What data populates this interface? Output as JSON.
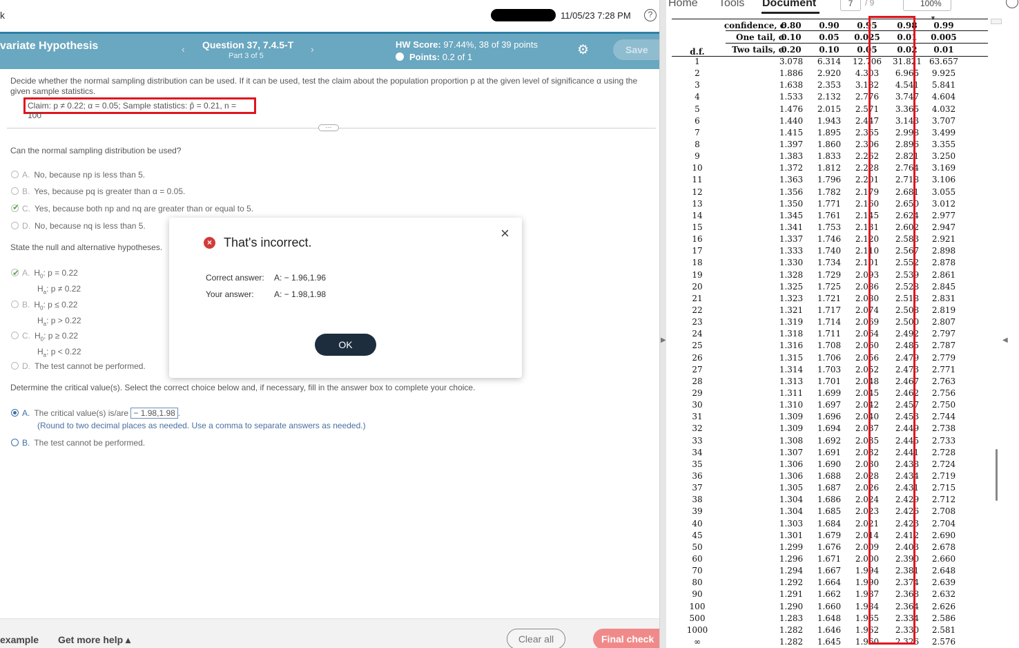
{
  "topbar": {
    "back": "k",
    "timestamp": "11/05/23 7:28 PM",
    "help": "?"
  },
  "header": {
    "title": "variate Hypothesis",
    "question_title": "Question 37, 7.4.5-T",
    "question_part": "Part 3 of 5",
    "prev": "‹",
    "next": "›",
    "hw_score_label": "HW Score:",
    "hw_score_value": "97.44%, 38 of 39 points",
    "points_label": "Points:",
    "points_value": "0.2 of 1",
    "save_label": "Save"
  },
  "content": {
    "intro": "Decide whether the normal sampling distribution can be used. If it can be used, test the claim about the population proportion p at the given level of significance α using the given sample statistics.",
    "claim": "Claim: p ≠ 0.22; α = 0.05; Sample statistics: p̂ = 0.21, n = 100",
    "q1": "Can the normal sampling distribution be used?",
    "q1_options": [
      {
        "letter": "A.",
        "text": "No, because np is less than 5."
      },
      {
        "letter": "B.",
        "text": "Yes, because pq is greater than α = 0.05."
      },
      {
        "letter": "C.",
        "text": "Yes, because both np and nq are greater than or equal to 5."
      },
      {
        "letter": "D.",
        "text": "No, because nq is less than 5."
      }
    ],
    "q2": "State the null and alternative hypotheses.",
    "q2_options": [
      {
        "letter": "A.",
        "h0": "p = 0.22",
        "ha": "p ≠ 0.22"
      },
      {
        "letter": "B.",
        "h0": "p ≤ 0.22",
        "ha": "p > 0.22"
      },
      {
        "letter": "C.",
        "h0": "p ≥ 0.22",
        "ha": "p < 0.22"
      },
      {
        "letter": "D.",
        "text": "The test cannot be performed."
      }
    ],
    "h0_label": "H",
    "h0_sub": "0",
    "ha_label": "H",
    "ha_sub": "a",
    "q3": "Determine the critical value(s). Select the correct choice below and, if necessary, fill in the answer box to complete your choice.",
    "q3_a_letter": "A.",
    "q3_a_text": "The critical value(s) is/are",
    "q3_a_answer": "− 1.98,1.98",
    "q3_a_period": ".",
    "q3_a_hint": "(Round to two decimal places as needed. Use a comma to separate answers as needed.)",
    "q3_b_letter": "B.",
    "q3_b_text": "The test cannot be performed."
  },
  "modal": {
    "title": "That's incorrect.",
    "correct_label": "Correct answer:",
    "correct_value": "A:  − 1.96,1.96",
    "your_label": "Your answer:",
    "your_value": "A:  − 1.98,1.98",
    "ok_label": "OK",
    "close": "×"
  },
  "bottom": {
    "example": "example",
    "more_help": "Get more help ▴",
    "clear_all": "Clear all",
    "final_check": "Final check"
  },
  "viewer": {
    "tabs": [
      "Home",
      "Tools",
      "Document"
    ],
    "page_current": "7",
    "page_total": "/ 9",
    "zoom": "100%",
    "more": "•••"
  },
  "t_table": {
    "header_labels": [
      "confidence, c",
      "One tail, α",
      "Two tails, α"
    ],
    "df_label": "d.f.",
    "confidence": [
      "0.80",
      "0.90",
      "0.95",
      "0.98",
      "0.99"
    ],
    "one_tail": [
      "0.10",
      "0.05",
      "0.025",
      "0.01",
      "0.005"
    ],
    "two_tails": [
      "0.20",
      "0.10",
      "0.05",
      "0.02",
      "0.01"
    ],
    "rows": [
      [
        "1",
        "3.078",
        "6.314",
        "12.706",
        "31.821",
        "63.657"
      ],
      [
        "2",
        "1.886",
        "2.920",
        "4.303",
        "6.965",
        "9.925"
      ],
      [
        "3",
        "1.638",
        "2.353",
        "3.182",
        "4.541",
        "5.841"
      ],
      [
        "4",
        "1.533",
        "2.132",
        "2.776",
        "3.747",
        "4.604"
      ],
      [
        "5",
        "1.476",
        "2.015",
        "2.571",
        "3.365",
        "4.032"
      ],
      [
        "6",
        "1.440",
        "1.943",
        "2.447",
        "3.143",
        "3.707"
      ],
      [
        "7",
        "1.415",
        "1.895",
        "2.365",
        "2.998",
        "3.499"
      ],
      [
        "8",
        "1.397",
        "1.860",
        "2.306",
        "2.896",
        "3.355"
      ],
      [
        "9",
        "1.383",
        "1.833",
        "2.262",
        "2.821",
        "3.250"
      ],
      [
        "10",
        "1.372",
        "1.812",
        "2.228",
        "2.764",
        "3.169"
      ],
      [
        "11",
        "1.363",
        "1.796",
        "2.201",
        "2.718",
        "3.106"
      ],
      [
        "12",
        "1.356",
        "1.782",
        "2.179",
        "2.681",
        "3.055"
      ],
      [
        "13",
        "1.350",
        "1.771",
        "2.160",
        "2.650",
        "3.012"
      ],
      [
        "14",
        "1.345",
        "1.761",
        "2.145",
        "2.624",
        "2.977"
      ],
      [
        "15",
        "1.341",
        "1.753",
        "2.131",
        "2.602",
        "2.947"
      ],
      [
        "16",
        "1.337",
        "1.746",
        "2.120",
        "2.583",
        "2.921"
      ],
      [
        "17",
        "1.333",
        "1.740",
        "2.110",
        "2.567",
        "2.898"
      ],
      [
        "18",
        "1.330",
        "1.734",
        "2.101",
        "2.552",
        "2.878"
      ],
      [
        "19",
        "1.328",
        "1.729",
        "2.093",
        "2.539",
        "2.861"
      ],
      [
        "20",
        "1.325",
        "1.725",
        "2.086",
        "2.528",
        "2.845"
      ],
      [
        "21",
        "1.323",
        "1.721",
        "2.080",
        "2.518",
        "2.831"
      ],
      [
        "22",
        "1.321",
        "1.717",
        "2.074",
        "2.508",
        "2.819"
      ],
      [
        "23",
        "1.319",
        "1.714",
        "2.069",
        "2.500",
        "2.807"
      ],
      [
        "24",
        "1.318",
        "1.711",
        "2.064",
        "2.492",
        "2.797"
      ],
      [
        "25",
        "1.316",
        "1.708",
        "2.060",
        "2.485",
        "2.787"
      ],
      [
        "26",
        "1.315",
        "1.706",
        "2.056",
        "2.479",
        "2.779"
      ],
      [
        "27",
        "1.314",
        "1.703",
        "2.052",
        "2.473",
        "2.771"
      ],
      [
        "28",
        "1.313",
        "1.701",
        "2.048",
        "2.467",
        "2.763"
      ],
      [
        "29",
        "1.311",
        "1.699",
        "2.045",
        "2.462",
        "2.756"
      ],
      [
        "30",
        "1.310",
        "1.697",
        "2.042",
        "2.457",
        "2.750"
      ],
      [
        "31",
        "1.309",
        "1.696",
        "2.040",
        "2.453",
        "2.744"
      ],
      [
        "32",
        "1.309",
        "1.694",
        "2.037",
        "2.449",
        "2.738"
      ],
      [
        "33",
        "1.308",
        "1.692",
        "2.035",
        "2.445",
        "2.733"
      ],
      [
        "34",
        "1.307",
        "1.691",
        "2.032",
        "2.441",
        "2.728"
      ],
      [
        "35",
        "1.306",
        "1.690",
        "2.030",
        "2.438",
        "2.724"
      ],
      [
        "36",
        "1.306",
        "1.688",
        "2.028",
        "2.434",
        "2.719"
      ],
      [
        "37",
        "1.305",
        "1.687",
        "2.026",
        "2.431",
        "2.715"
      ],
      [
        "38",
        "1.304",
        "1.686",
        "2.024",
        "2.429",
        "2.712"
      ],
      [
        "39",
        "1.304",
        "1.685",
        "2.023",
        "2.426",
        "2.708"
      ],
      [
        "40",
        "1.303",
        "1.684",
        "2.021",
        "2.423",
        "2.704"
      ],
      [
        "45",
        "1.301",
        "1.679",
        "2.014",
        "2.412",
        "2.690"
      ],
      [
        "50",
        "1.299",
        "1.676",
        "2.009",
        "2.403",
        "2.678"
      ],
      [
        "60",
        "1.296",
        "1.671",
        "2.000",
        "2.390",
        "2.660"
      ],
      [
        "70",
        "1.294",
        "1.667",
        "1.994",
        "2.381",
        "2.648"
      ],
      [
        "80",
        "1.292",
        "1.664",
        "1.990",
        "2.374",
        "2.639"
      ],
      [
        "90",
        "1.291",
        "1.662",
        "1.987",
        "2.368",
        "2.632"
      ],
      [
        "100",
        "1.290",
        "1.660",
        "1.984",
        "2.364",
        "2.626"
      ],
      [
        "500",
        "1.283",
        "1.648",
        "1.965",
        "2.334",
        "2.586"
      ],
      [
        "1000",
        "1.282",
        "1.646",
        "1.962",
        "2.330",
        "2.581"
      ],
      [
        "∞",
        "1.282",
        "1.645",
        "1.960",
        "2.326",
        "2.576"
      ]
    ]
  },
  "colors": {
    "header_bg": "#6aa7c0",
    "highlight_red": "#e0141e",
    "ok_button": "#1d2d3e",
    "final_check": "#f08a8a"
  }
}
